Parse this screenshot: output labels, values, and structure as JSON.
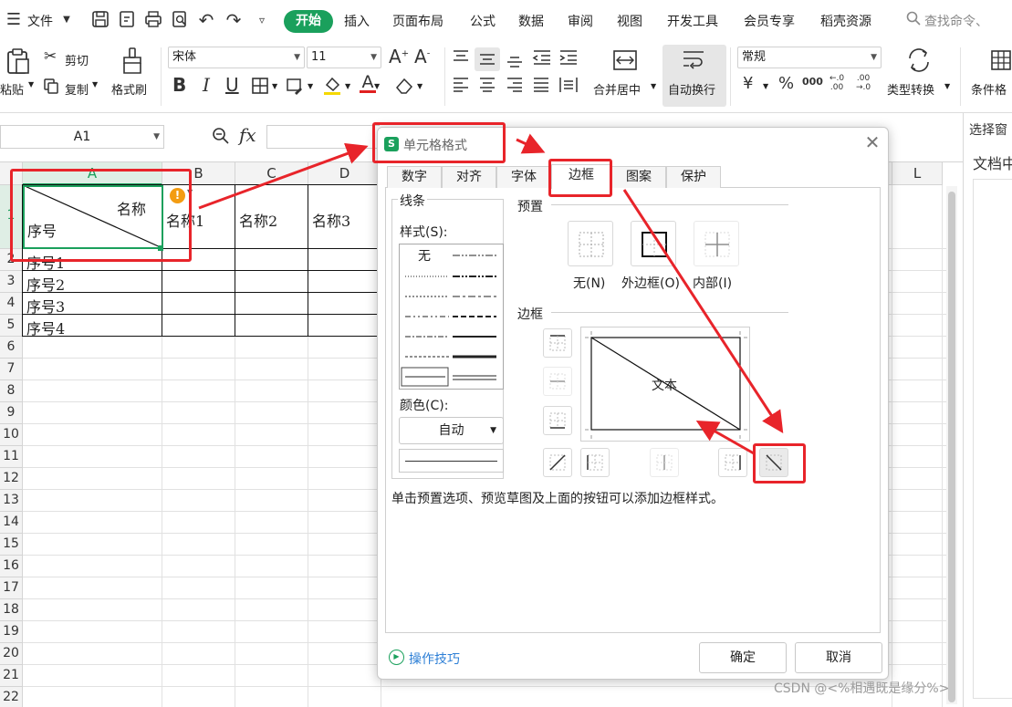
{
  "menubar": {
    "file": "文件",
    "tabs": [
      "开始",
      "插入",
      "页面布局",
      "公式",
      "数据",
      "审阅",
      "视图",
      "开发工具",
      "会员专享",
      "稻壳资源"
    ],
    "search": "查找命令、"
  },
  "ribbon": {
    "paste": "粘贴",
    "cut": "剪切",
    "copy": "复制",
    "format_painter": "格式刷",
    "font_name": "宋体",
    "font_size": "11",
    "merge_center": "合并居中",
    "wrap_text": "自动换行",
    "number_format": "常规",
    "type_convert": "类型转换",
    "conditional": "条件格"
  },
  "formula_bar": {
    "name_box": "A1",
    "fx": "fx"
  },
  "grid": {
    "columns": [
      "A",
      "B",
      "C",
      "D",
      "L"
    ],
    "rows": [
      "1",
      "2",
      "3",
      "4",
      "5",
      "6",
      "7",
      "8",
      "9",
      "10",
      "11",
      "12",
      "13",
      "14",
      "15",
      "16",
      "17",
      "18",
      "19",
      "20",
      "21",
      "22"
    ],
    "a1_top": "名称",
    "a1_bottom": "序号",
    "headers": [
      "名称1",
      "名称2",
      "名称3"
    ],
    "row_labels": [
      "序号1",
      "序号2",
      "序号3",
      "序号4"
    ]
  },
  "side_panel": {
    "title": "选择窗",
    "doc": "文档中"
  },
  "dialog": {
    "title": "单元格格式",
    "tabs": [
      "数字",
      "对齐",
      "字体",
      "边框",
      "图案",
      "保护"
    ],
    "active_tab": "边框",
    "line_group": "线条",
    "style_label": "样式(S):",
    "style_none": "无",
    "color_label": "颜色(C):",
    "color_value": "自动",
    "preset_group": "预置",
    "preset_none": "无(N)",
    "preset_outline": "外边框(O)",
    "preset_inside": "内部(I)",
    "border_group": "边框",
    "preview_text": "文本",
    "hint": "单击预置选项、预览草图及上面的按钮可以添加边框样式。",
    "tips": "操作技巧",
    "ok": "确定",
    "cancel": "取消"
  },
  "watermark": "CSDN @<%相遇既是缘分%>",
  "colors": {
    "accent": "#1aa05c",
    "annotation": "#e8242a",
    "link": "#2d7fd6"
  }
}
